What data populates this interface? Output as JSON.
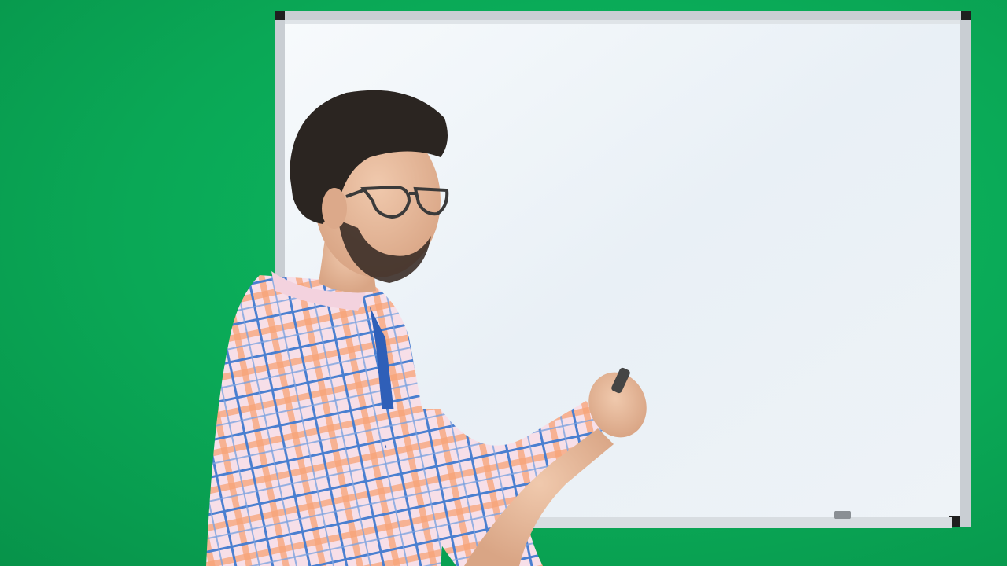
{
  "scene": {
    "colors": {
      "wall": "#0aa856",
      "board_surface": "#eef3f8",
      "board_frame": "#c9ced3",
      "shirt_base": "#f6dce6",
      "shirt_check_blue": "#4a7fd0",
      "shirt_check_orange": "#f4955e",
      "undershirt": "#2f5fb8",
      "hair": "#2b2521",
      "skin": "#e8bfa2",
      "glasses": "#3a3a3a"
    },
    "icons": [
      "whiteboard",
      "person-presenter",
      "marker"
    ]
  }
}
